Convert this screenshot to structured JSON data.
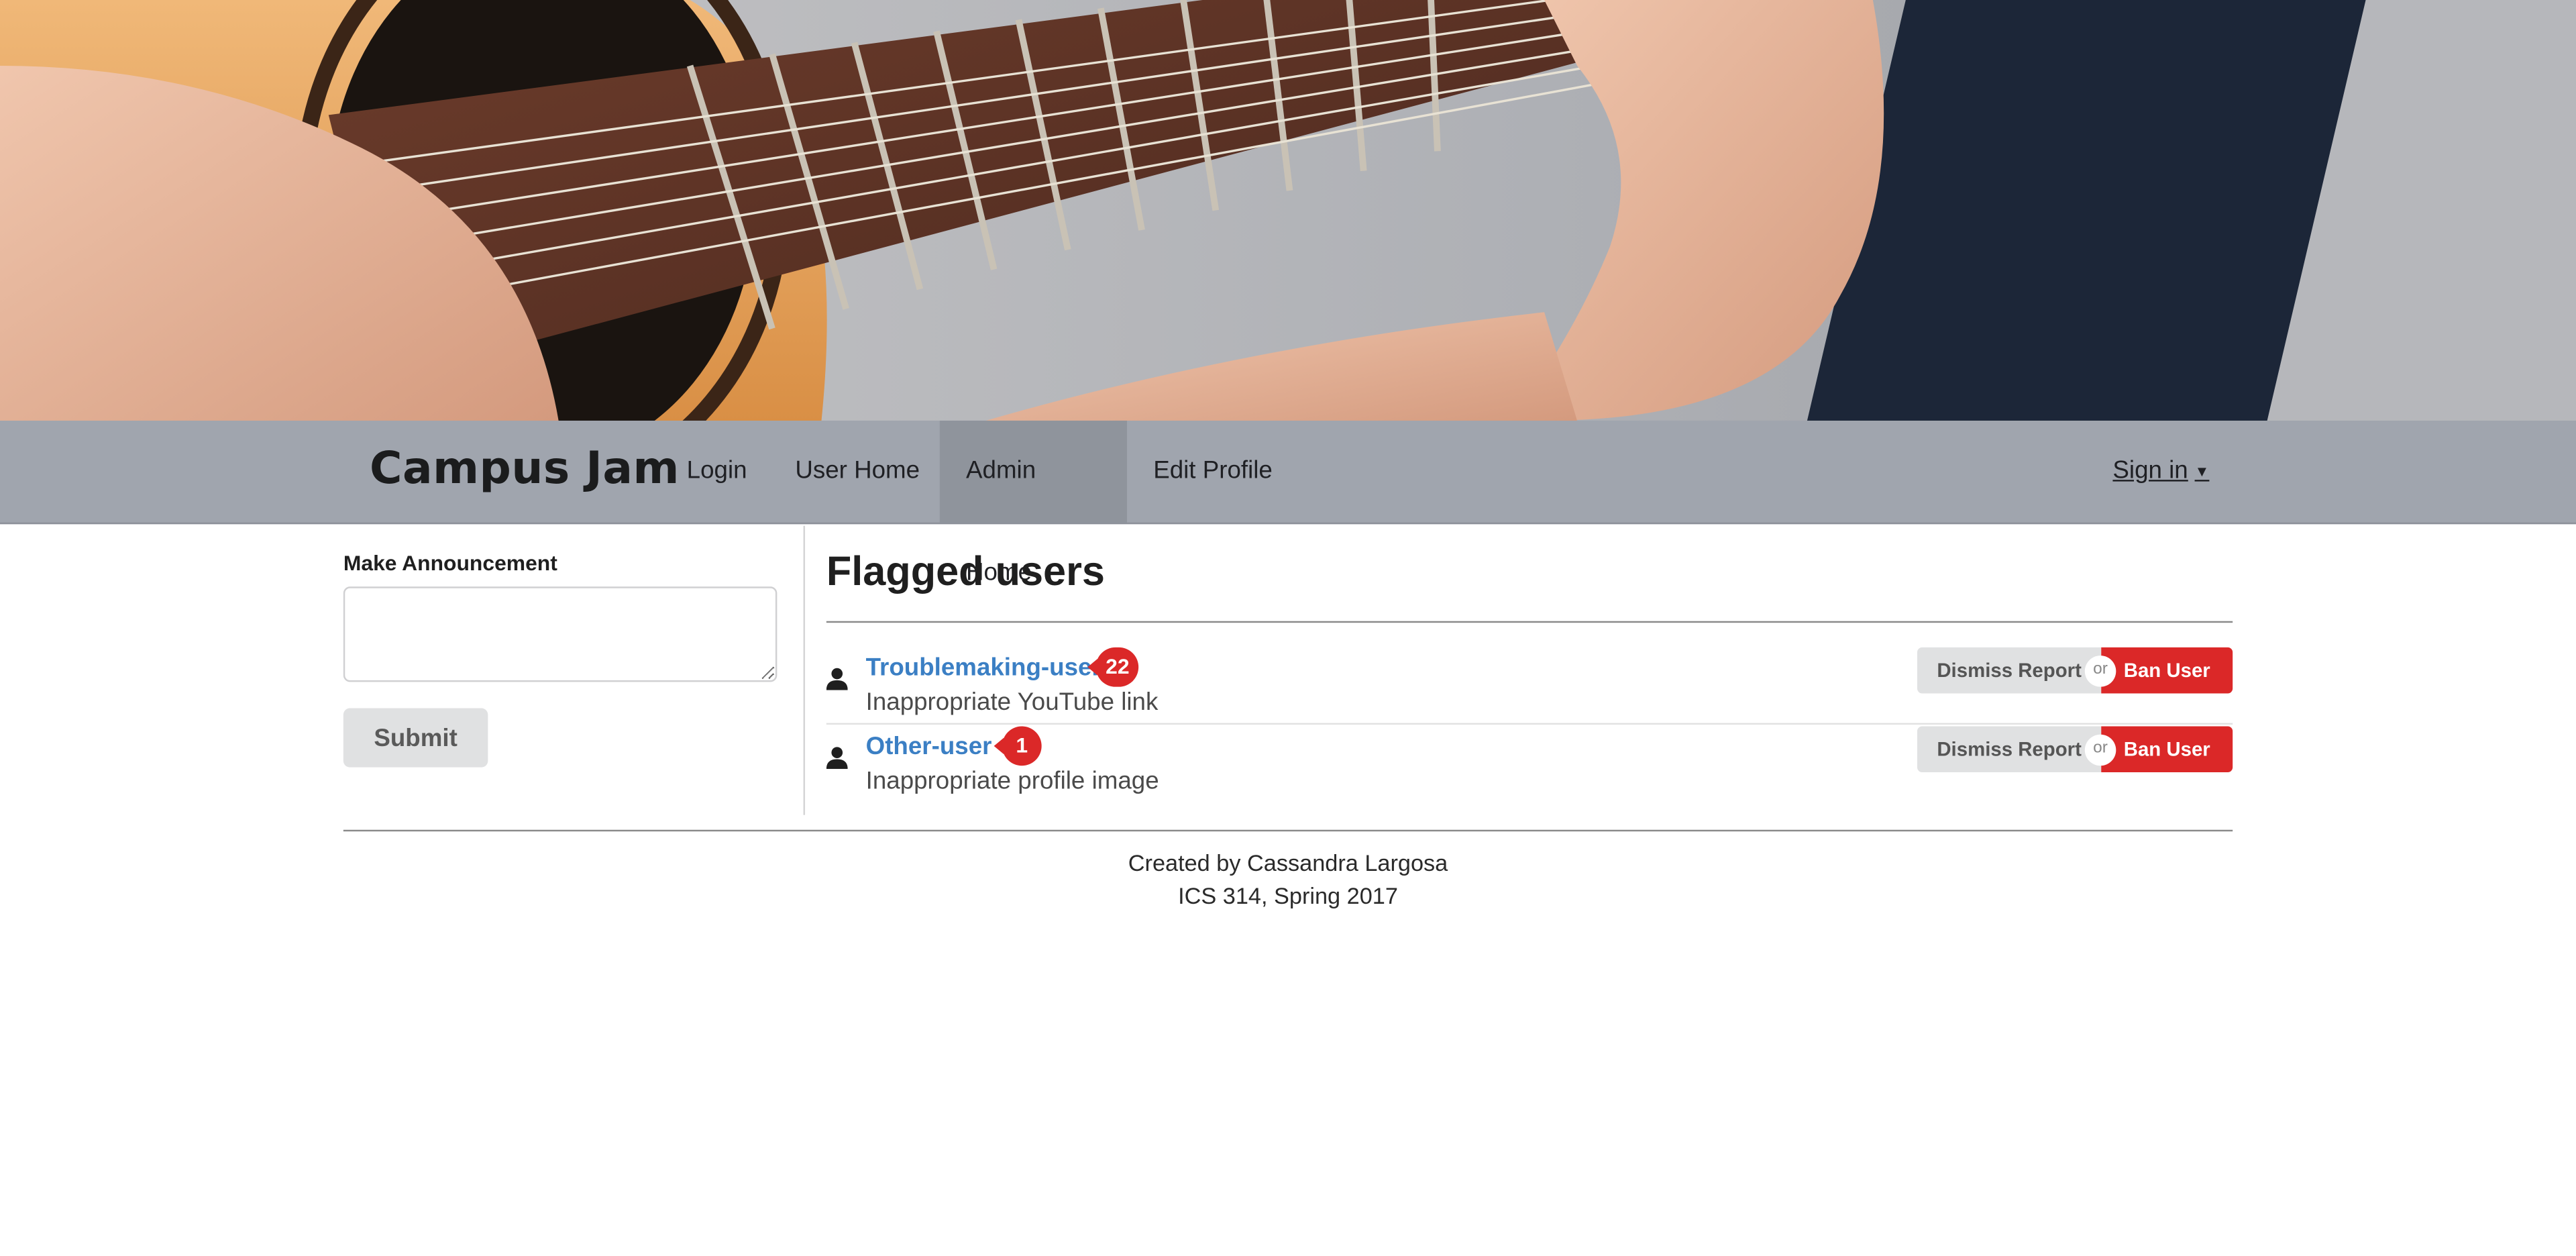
{
  "nav": {
    "brand": "Campus Jam",
    "items": [
      {
        "label": "Login",
        "active": false
      },
      {
        "label": "User Home",
        "active": false
      },
      {
        "label": "Admin Home",
        "active": true
      },
      {
        "label": "Edit Profile",
        "active": false
      }
    ],
    "signin_label": "Sign in"
  },
  "announcement": {
    "label": "Make Announcement",
    "value": "",
    "submit_label": "Submit"
  },
  "flagged": {
    "title": "Flagged users",
    "users": [
      {
        "name": "Troublemaking-user",
        "count": "22",
        "reason": "Inappropriate YouTube link"
      },
      {
        "name": "Other-user",
        "count": "1",
        "reason": "Inappropriate profile image"
      }
    ],
    "dismiss_label": "Dismiss Report",
    "or_label": "or",
    "ban_label": "Ban User"
  },
  "footer": {
    "line1": "Created by Cassandra Largosa",
    "line2": "ICS 314, Spring 2017"
  },
  "colors": {
    "navbar": "#a0a5ae",
    "link": "#3b7fc4",
    "danger": "#db2828",
    "neutral_button": "#e0e1e2"
  },
  "hero_image": "guitar-player-photo"
}
